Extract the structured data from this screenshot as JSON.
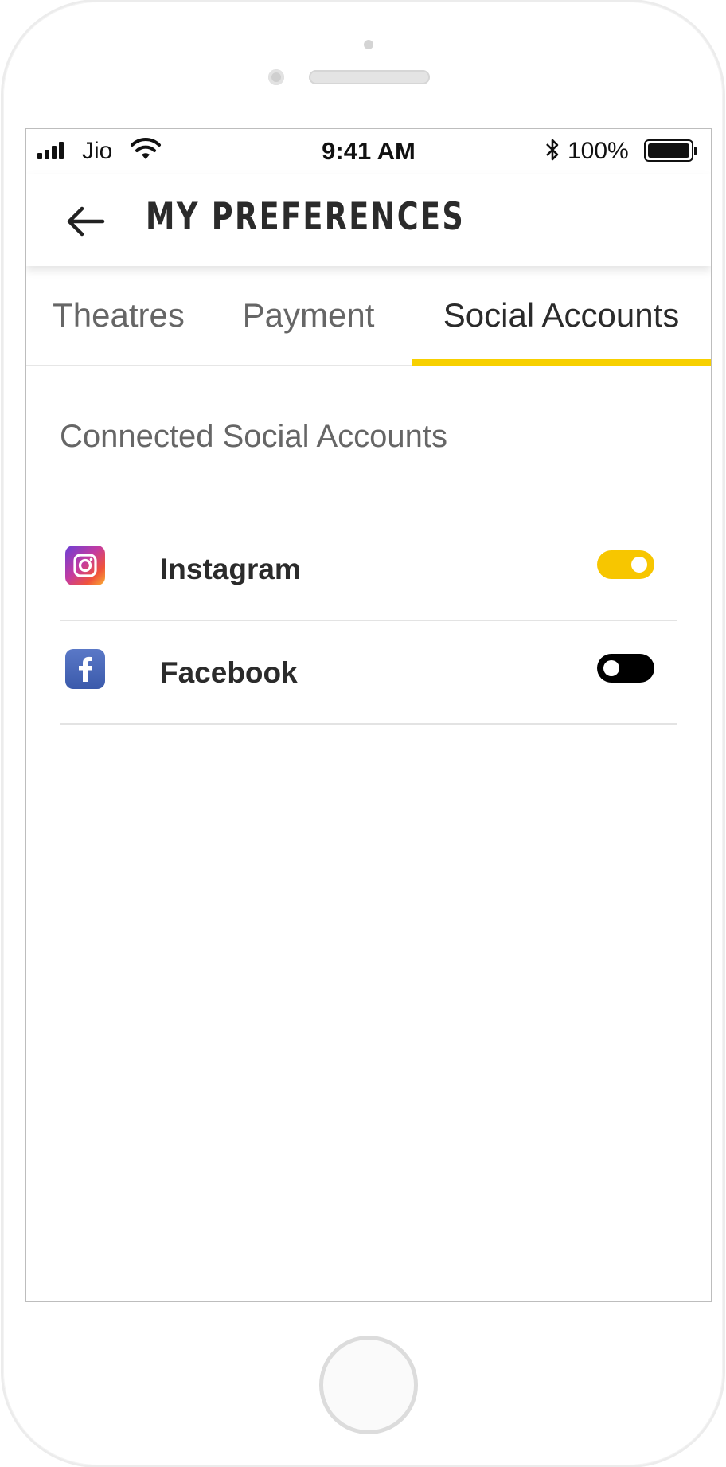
{
  "status_bar": {
    "carrier": "Jio",
    "time": "9:41 AM",
    "battery_percent": "100%"
  },
  "header": {
    "title": "MY PREFERENCES"
  },
  "tabs": [
    {
      "label": "Theatres",
      "active": false
    },
    {
      "label": "Payment",
      "active": false
    },
    {
      "label": "Social Accounts",
      "active": true
    }
  ],
  "section": {
    "heading": "Connected Social Accounts"
  },
  "accounts": [
    {
      "name": "Instagram",
      "icon": "instagram-icon",
      "connected": true
    },
    {
      "name": "Facebook",
      "icon": "facebook-icon",
      "connected": false
    }
  ],
  "colors": {
    "accent": "#f7d000",
    "toggle_on": "#f7c600",
    "toggle_off": "#000000",
    "text_primary": "#2b2b2b",
    "text_secondary": "#666666"
  }
}
